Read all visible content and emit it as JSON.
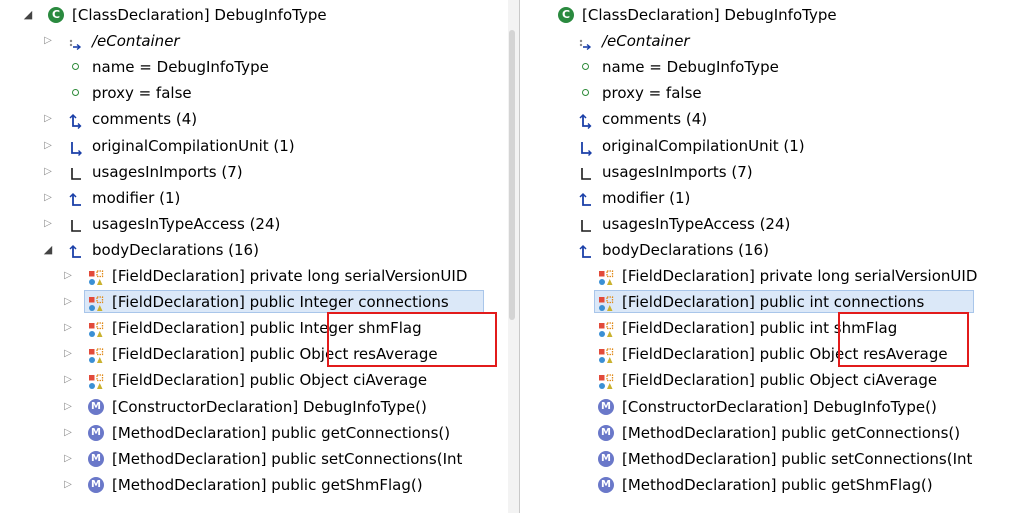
{
  "panels": [
    {
      "id": "left",
      "rows": [
        {
          "arrow": "open",
          "indent": 0,
          "icon": "class",
          "text": "[ClassDeclaration] DebugInfoType"
        },
        {
          "arrow": "closed",
          "indent": 1,
          "icon": "container",
          "text": "/eContainer",
          "italic": true
        },
        {
          "arrow": "none",
          "indent": 1,
          "icon": "attr",
          "text": "name = DebugInfoType"
        },
        {
          "arrow": "none",
          "indent": 1,
          "icon": "attr",
          "text": "proxy = false"
        },
        {
          "arrow": "closed",
          "indent": 1,
          "icon": "ref-up-arrow",
          "text": "comments (4)"
        },
        {
          "arrow": "closed",
          "indent": 1,
          "icon": "ref-arrow",
          "text": "originalCompilationUnit (1)"
        },
        {
          "arrow": "closed",
          "indent": 1,
          "icon": "ref-l",
          "text": "usagesInImports (7)"
        },
        {
          "arrow": "closed",
          "indent": 1,
          "icon": "ref-up",
          "text": "modifier (1)"
        },
        {
          "arrow": "closed",
          "indent": 1,
          "icon": "ref-l",
          "text": "usagesInTypeAccess (24)"
        },
        {
          "arrow": "open",
          "indent": 1,
          "icon": "ref-up",
          "text": "bodyDeclarations (16)"
        },
        {
          "arrow": "closed",
          "indent": 2,
          "icon": "field",
          "text": "[FieldDeclaration] private long serialVersionUID"
        },
        {
          "arrow": "closed",
          "indent": 2,
          "icon": "field",
          "text": "[FieldDeclaration] public Integer connections",
          "selected": true
        },
        {
          "arrow": "closed",
          "indent": 2,
          "icon": "field",
          "text": "[FieldDeclaration] public Integer shmFlag"
        },
        {
          "arrow": "closed",
          "indent": 2,
          "icon": "field",
          "text": "[FieldDeclaration] public Object resAverage"
        },
        {
          "arrow": "closed",
          "indent": 2,
          "icon": "field",
          "text": "[FieldDeclaration] public Object ciAverage"
        },
        {
          "arrow": "closed",
          "indent": 2,
          "icon": "method",
          "text": "[ConstructorDeclaration] DebugInfoType()"
        },
        {
          "arrow": "closed",
          "indent": 2,
          "icon": "method",
          "text": "[MethodDeclaration] public getConnections()"
        },
        {
          "arrow": "closed",
          "indent": 2,
          "icon": "method",
          "text": "[MethodDeclaration] public setConnections(Int"
        },
        {
          "arrow": "closed",
          "indent": 2,
          "icon": "method",
          "text": "[MethodDeclaration] public getShmFlag()"
        }
      ]
    },
    {
      "id": "right",
      "rows": [
        {
          "arrow": "none",
          "indent": 0,
          "icon": "class",
          "text": "[ClassDeclaration] DebugInfoType"
        },
        {
          "arrow": "none",
          "indent": 1,
          "icon": "container",
          "text": "/eContainer",
          "italic": true
        },
        {
          "arrow": "none",
          "indent": 1,
          "icon": "attr",
          "text": "name = DebugInfoType"
        },
        {
          "arrow": "none",
          "indent": 1,
          "icon": "attr",
          "text": "proxy = false"
        },
        {
          "arrow": "none",
          "indent": 1,
          "icon": "ref-up-arrow",
          "text": "comments (4)"
        },
        {
          "arrow": "none",
          "indent": 1,
          "icon": "ref-arrow",
          "text": "originalCompilationUnit (1)"
        },
        {
          "arrow": "none",
          "indent": 1,
          "icon": "ref-l",
          "text": "usagesInImports (7)"
        },
        {
          "arrow": "none",
          "indent": 1,
          "icon": "ref-up",
          "text": "modifier (1)"
        },
        {
          "arrow": "none",
          "indent": 1,
          "icon": "ref-l",
          "text": "usagesInTypeAccess (24)"
        },
        {
          "arrow": "none",
          "indent": 1,
          "icon": "ref-up",
          "text": "bodyDeclarations (16)"
        },
        {
          "arrow": "none",
          "indent": 2,
          "icon": "field",
          "text": "[FieldDeclaration] private long serialVersionUID"
        },
        {
          "arrow": "none",
          "indent": 2,
          "icon": "field",
          "text": "[FieldDeclaration] public int connections",
          "selected": true
        },
        {
          "arrow": "none",
          "indent": 2,
          "icon": "field",
          "text": "[FieldDeclaration] public int shmFlag"
        },
        {
          "arrow": "none",
          "indent": 2,
          "icon": "field",
          "text": "[FieldDeclaration] public Object resAverage"
        },
        {
          "arrow": "none",
          "indent": 2,
          "icon": "field",
          "text": "[FieldDeclaration] public Object ciAverage"
        },
        {
          "arrow": "none",
          "indent": 2,
          "icon": "method",
          "text": "[ConstructorDeclaration] DebugInfoType()"
        },
        {
          "arrow": "none",
          "indent": 2,
          "icon": "method",
          "text": "[MethodDeclaration] public getConnections()"
        },
        {
          "arrow": "none",
          "indent": 2,
          "icon": "method",
          "text": "[MethodDeclaration] public setConnections(Int"
        },
        {
          "arrow": "none",
          "indent": 2,
          "icon": "method",
          "text": "[MethodDeclaration] public getShmFlag()"
        }
      ]
    }
  ],
  "colors": {
    "highlight_box": "#e21b1b",
    "selection": "#dbe8f8",
    "class_icon": "#2a8a3f",
    "method_icon": "#6a78c9",
    "ref_icon": "#1a3fa8"
  }
}
